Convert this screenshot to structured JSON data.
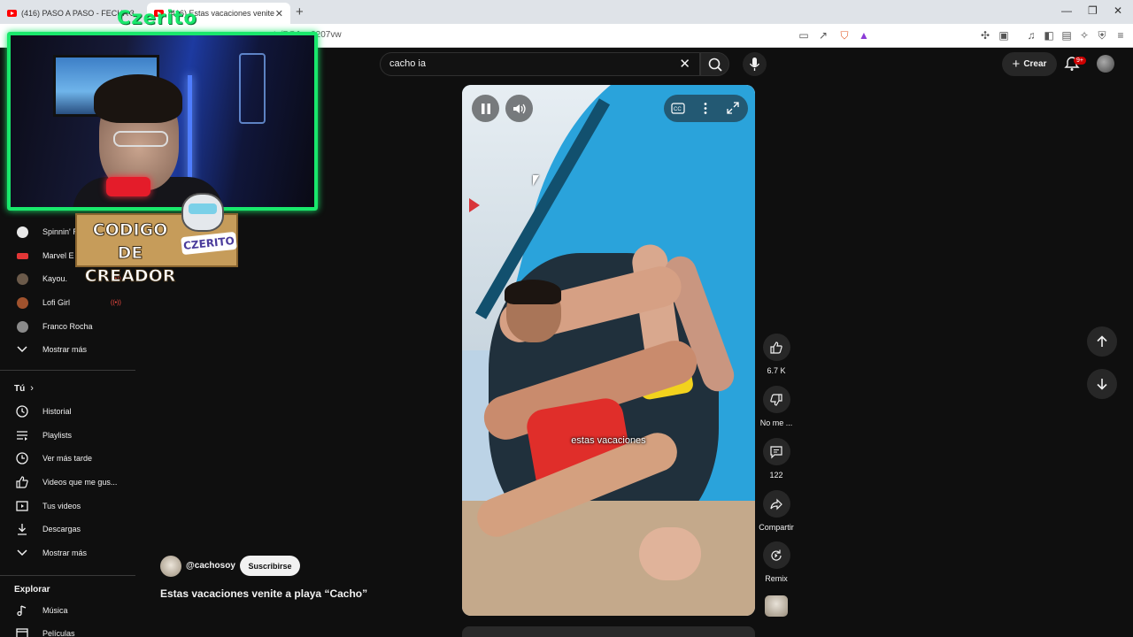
{
  "browser": {
    "tabs": [
      {
        "title": "(416) PASO A PASO - FECHA 3"
      },
      {
        "title": "(416) Estas vacaciones venite"
      }
    ],
    "address": "…orts/BGJxw2207vw"
  },
  "topbar": {
    "search_value": "cacho ia",
    "create_label": "Crear",
    "notification_badge": "9+"
  },
  "overlay": {
    "streamer_label": "Czerito",
    "code_badge": "CODIGO DE CREADOR",
    "code_name": "CZERITO"
  },
  "sidebar": {
    "subscriptions": [
      {
        "label": "Spinnin' R",
        "color": "#e8e8e8"
      },
      {
        "label": "Marvel E",
        "color": "#e23636"
      },
      {
        "label": "Kayou.",
        "color": "#6b5a4a",
        "live": "((•))"
      },
      {
        "label": "Lofi Girl",
        "color": "#a0522d",
        "live": "((•))"
      },
      {
        "label": "Franco Rocha",
        "color": "#8a8a8a"
      }
    ],
    "show_more_1": "Mostrar más",
    "you_heading": "Tú",
    "you_items": [
      {
        "label": "Historial",
        "icon": "history-icon"
      },
      {
        "label": "Playlists",
        "icon": "playlists-icon"
      },
      {
        "label": "Ver más tarde",
        "icon": "watch-later-icon"
      },
      {
        "label": "Videos que me gus...",
        "icon": "liked-icon"
      },
      {
        "label": "Tus videos",
        "icon": "your-videos-icon"
      },
      {
        "label": "Descargas",
        "icon": "downloads-icon"
      }
    ],
    "show_more_2": "Mostrar más",
    "explore_heading": "Explorar",
    "explore_items": [
      {
        "label": "Música",
        "icon": "music-icon"
      },
      {
        "label": "Películas",
        "icon": "movies-icon"
      }
    ]
  },
  "video": {
    "caption": "estas vacaciones",
    "channel_handle": "@cachosoy",
    "subscribe_label": "Suscribirse",
    "title": "Estas vacaciones venite a playa “Cacho”"
  },
  "actions": {
    "likes": "6.7 K",
    "dislike_label": "No me ...",
    "comments": "122",
    "share_label": "Compartir",
    "remix_label": "Remix"
  },
  "colors": {
    "accent_green": "#19e86c",
    "youtube_red": "#ff0000",
    "background": "#0f0f0f"
  }
}
